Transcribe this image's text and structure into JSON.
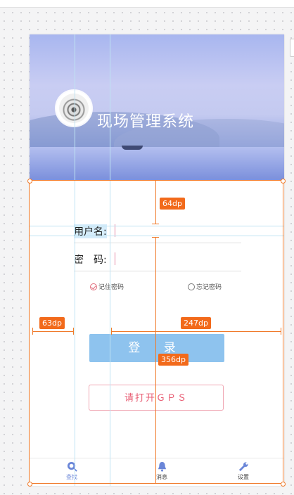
{
  "app": {
    "title": "现场管理系统"
  },
  "form": {
    "username_label": "用户名:",
    "password_label": "密　码:",
    "remember_label": "记住密码",
    "forget_label": "忘记密码",
    "login_label": "登 录",
    "gps_label": "请打开ＧＰＳ"
  },
  "tabs": [
    {
      "label": "查找",
      "icon": "search-icon"
    },
    {
      "label": "消息",
      "icon": "bell-icon"
    },
    {
      "label": "设置",
      "icon": "wrench-icon"
    }
  ],
  "annotations": {
    "top_gap": "64dp",
    "left_gap": "63dp",
    "right_width": "247dp",
    "height": "356dp"
  },
  "colors": {
    "accent": "#8ec3ee",
    "gps_border": "#f0a6b3",
    "gps_text": "#e85d73",
    "annotation": "#f26a1b",
    "tab_active": "#6a86d8"
  }
}
